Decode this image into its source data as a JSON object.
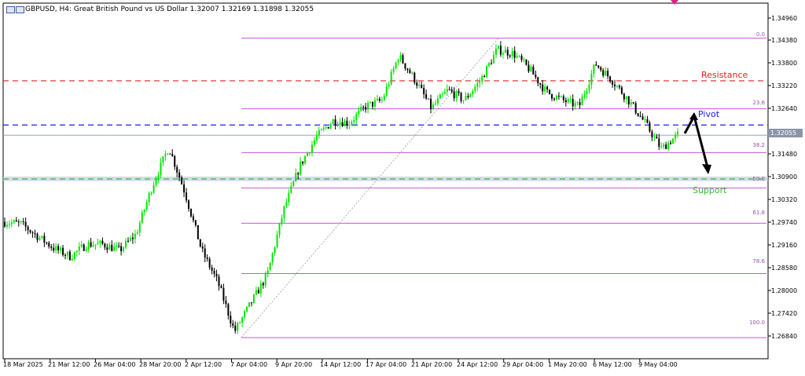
{
  "header": {
    "title": "GBPUSD, H4:  Great British Pound vs US Dollar  1.32007 1.32169 1.31898 1.32055"
  },
  "annotations": {
    "resistance": "Resistance",
    "pivot": "Pivot",
    "support": "Support"
  },
  "fib_levels": [
    "0.0",
    "23.6",
    "38.2",
    "50.0",
    "61.8",
    "78.6",
    "100.0"
  ],
  "current_price": "1.32055",
  "y_ticks": [
    "1.34960",
    "1.34380",
    "1.33800",
    "1.33220",
    "1.32640",
    "1.31480",
    "1.30900",
    "1.30320",
    "1.29740",
    "1.29160",
    "1.28580",
    "1.28000",
    "1.27420",
    "1.26840"
  ],
  "x_ticks": [
    "18 Mar 2025",
    "21 Mar 12:00",
    "26 Mar 04:00",
    "28 Mar 20:00",
    "2 Apr 12:00",
    "7 Apr 04:00",
    "9 Apr 20:00",
    "14 Apr 12:00",
    "17 Apr 04:00",
    "21 Apr 20:00",
    "24 Apr 12:00",
    "29 Apr 04:00",
    "1 May 20:00",
    "6 May 12:00",
    "9 May 04:00"
  ],
  "colors": {
    "bull": "#00e600",
    "bear": "#000000",
    "resistance": "#e02020",
    "pivot": "#1a1aff",
    "support": "#33bb33",
    "fib": "#c05ad0"
  },
  "chart_data": {
    "type": "candlestick",
    "symbol": "GBPUSD",
    "timeframe": "H4",
    "ylim": [
      1.2655,
      1.351
    ],
    "close_path": [
      [
        "18 Mar 2025",
        1.299
      ],
      [
        "20 Mar",
        1.2985
      ],
      [
        "21 Mar 12:00",
        1.2955
      ],
      [
        "24 Mar",
        1.2925
      ],
      [
        "26 Mar 04:00",
        1.2905
      ],
      [
        "27 Mar",
        1.2935
      ],
      [
        "28 Mar 20:00",
        1.2935
      ],
      [
        "31 Mar",
        1.292
      ],
      [
        "2 Apr 00:00",
        1.296
      ],
      [
        "2 Apr 12:00",
        1.308
      ],
      [
        "3 Apr",
        1.3175
      ],
      [
        "4 Apr",
        1.306
      ],
      [
        "4 Apr 20:00",
        1.292
      ],
      [
        "7 Apr 00:00",
        1.284
      ],
      [
        "7 Apr 04:00",
        1.272
      ],
      [
        "8 Apr",
        1.279
      ],
      [
        "9 Apr 20:00",
        1.286
      ],
      [
        "10 Apr",
        1.302
      ],
      [
        "11 Apr",
        1.313
      ],
      [
        "14 Apr 12:00",
        1.32
      ],
      [
        "15 Apr",
        1.324
      ],
      [
        "16 Apr",
        1.3235
      ],
      [
        "17 Apr 04:00",
        1.3275
      ],
      [
        "18 Apr",
        1.329
      ],
      [
        "20 Apr",
        1.34
      ],
      [
        "21 Apr 20:00",
        1.334
      ],
      [
        "22 Apr",
        1.327
      ],
      [
        "23 Apr",
        1.3315
      ],
      [
        "24 Apr 12:00",
        1.329
      ],
      [
        "25 Apr",
        1.334
      ],
      [
        "28 Apr",
        1.3415
      ],
      [
        "29 Apr 04:00",
        1.3405
      ],
      [
        "29 Apr 20:00",
        1.3365
      ],
      [
        "30 Apr",
        1.331
      ],
      [
        "1 May 20:00",
        1.329
      ],
      [
        "2 May",
        1.3275
      ],
      [
        "5 May",
        1.338
      ],
      [
        "6 May 12:00",
        1.334
      ],
      [
        "7 May",
        1.329
      ],
      [
        "8 May",
        1.3235
      ],
      [
        "9 May 04:00",
        1.317
      ],
      [
        "9 May 20:00",
        1.3205
      ]
    ],
    "fibonacci": {
      "from_low": 1.2705,
      "to_high": 1.3443
    },
    "levels": {
      "resistance": 1.3338,
      "pivot": 1.3229,
      "support": 1.3096
    },
    "bands": [
      1.3091,
      1.3102
    ]
  }
}
